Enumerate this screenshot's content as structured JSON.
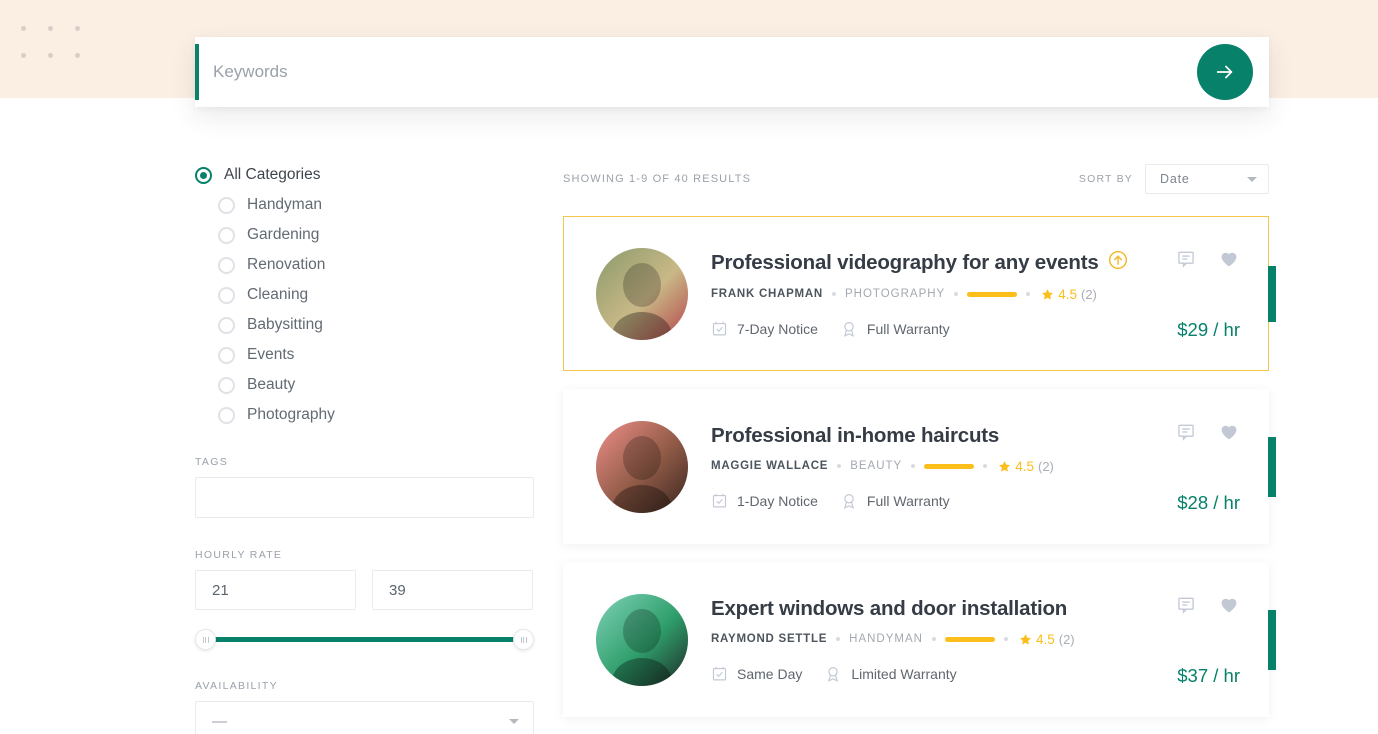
{
  "theme": {
    "accent_green": "#07816a",
    "accent_gold": "#fbbe1a",
    "banner_bg": "#fbeee3",
    "featured_border": "#f5c44a"
  },
  "search": {
    "placeholder": "Keywords",
    "value": "",
    "submit_icon": "arrow-right-icon"
  },
  "sidebar": {
    "categories": [
      {
        "label": "All Categories",
        "selected": true,
        "sub": false
      },
      {
        "label": "Handyman",
        "selected": false,
        "sub": true
      },
      {
        "label": "Gardening",
        "selected": false,
        "sub": true
      },
      {
        "label": "Renovation",
        "selected": false,
        "sub": true
      },
      {
        "label": "Cleaning",
        "selected": false,
        "sub": true
      },
      {
        "label": "Babysitting",
        "selected": false,
        "sub": true
      },
      {
        "label": "Events",
        "selected": false,
        "sub": true
      },
      {
        "label": "Beauty",
        "selected": false,
        "sub": true
      },
      {
        "label": "Photography",
        "selected": false,
        "sub": true
      }
    ],
    "tags": {
      "label": "Tags",
      "value": "",
      "placeholder": ""
    },
    "hourly_rate": {
      "label": "Hourly Rate",
      "min_value": "21",
      "max_value": "39",
      "slider_min_pct": 0,
      "slider_max_pct": 100
    },
    "availability": {
      "label": "Availability",
      "value": "—"
    }
  },
  "results_header": {
    "count_text": "Showing 1-9 of 40 results",
    "sort_label": "Sort by",
    "sort_value": "Date"
  },
  "cards": [
    {
      "title": "Professional videography for any events",
      "featured": true,
      "promo_badge": "arrow-up-circle-icon",
      "author": "Frank Chapman",
      "category": "Photography",
      "rating": "4.5",
      "rating_count": "(2)",
      "notice": "7-Day Notice",
      "warranty": "Full Warranty",
      "price": "$29 / hr",
      "avatar_colors": [
        "#8a9a6b",
        "#c9b887",
        "#b5454a"
      ]
    },
    {
      "title": "Professional in-home haircuts",
      "featured": false,
      "promo_badge": "",
      "author": "Maggie Wallace",
      "category": "Beauty",
      "rating": "4.5",
      "rating_count": "(2)",
      "notice": "1-Day Notice",
      "warranty": "Full Warranty",
      "price": "$28 / hr",
      "avatar_colors": [
        "#ef8f8a",
        "#8f5a46",
        "#3a2620"
      ]
    },
    {
      "title": "Expert windows and door installation",
      "featured": false,
      "promo_badge": "",
      "author": "Raymond Settle",
      "category": "Handyman",
      "rating": "4.5",
      "rating_count": "(2)",
      "notice": "Same Day",
      "warranty": "Limited Warranty",
      "price": "$37 / hr",
      "avatar_colors": [
        "#7fd2b8",
        "#2f9e6b",
        "#1e2a26"
      ]
    }
  ],
  "card_icons": {
    "comment": "comment-icon",
    "favorite": "heart-icon",
    "notice": "calendar-check-icon",
    "warranty": "award-ribbon-icon",
    "rating_star": "star-icon"
  }
}
